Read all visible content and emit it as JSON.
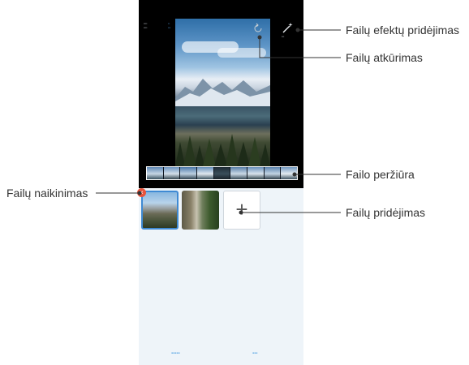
{
  "callouts": {
    "effects": "Failų efektų pridėjimas",
    "restore": "Failų atkūrimas",
    "preview": "Failo peržiūra",
    "delete": "Failų naikinimas",
    "add": "Failų pridėjimas"
  },
  "editor": {
    "add_symbol": "+",
    "delete_symbol": "×"
  },
  "colors": {
    "accent": "#3f8ad3",
    "delete_badge": "#e8533b",
    "callout_line": "#333333"
  }
}
